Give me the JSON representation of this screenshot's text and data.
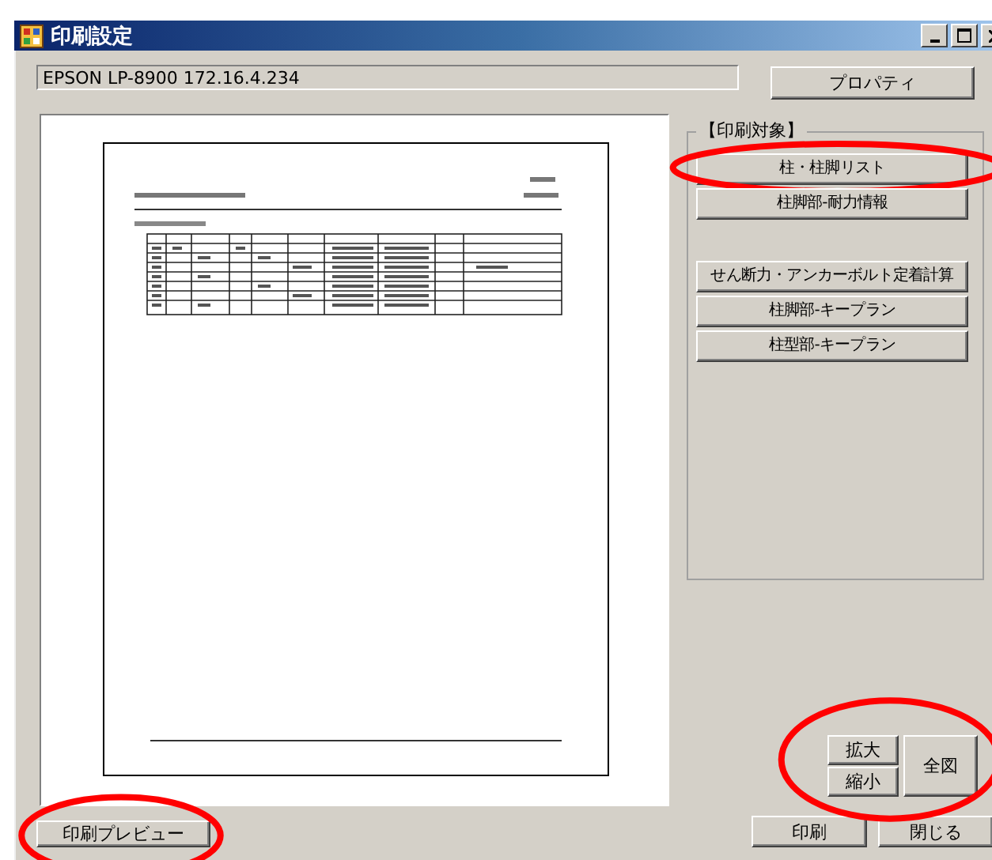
{
  "window": {
    "title": "印刷設定"
  },
  "printer": {
    "value": "EPSON LP-8900 172.16.4.234"
  },
  "properties_button": "プロパティ",
  "print_target": {
    "legend": "【印刷対象】",
    "button_groups": [
      [
        {
          "label": "柱・柱脚リスト",
          "annotated": true
        },
        {
          "label": "柱脚部-耐力情報",
          "annotated": false
        }
      ],
      [
        {
          "label": "せん断力・アンカーボルト定着計算",
          "annotated": false
        },
        {
          "label": "柱脚部-キープラン",
          "annotated": false
        },
        {
          "label": "柱型部-キープラン",
          "annotated": false
        }
      ]
    ]
  },
  "zoom": {
    "annotated": true,
    "zoom_in": "拡大",
    "zoom_out": "縮小",
    "fit": "全図"
  },
  "preview_button": {
    "label": "印刷プレビュー",
    "annotated": true
  },
  "print_button": "印刷",
  "close_button": "閉じる"
}
